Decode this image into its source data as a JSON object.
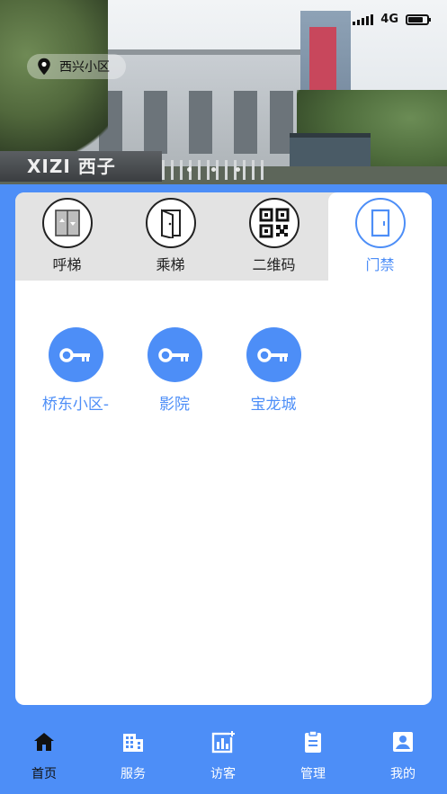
{
  "status_bar": {
    "network": "4G"
  },
  "header": {
    "location": "西兴小区",
    "banner_sign": "XIZI 西子",
    "banner_dots": 3
  },
  "tabs": [
    {
      "label": "呼梯",
      "icon": "call-elevator-icon",
      "active": false
    },
    {
      "label": "乘梯",
      "icon": "door-open-icon",
      "active": false
    },
    {
      "label": "二维码",
      "icon": "qr-code-icon",
      "active": false
    },
    {
      "label": "门禁",
      "icon": "door-icon",
      "active": true
    }
  ],
  "doors": [
    {
      "label": "桥东小区-",
      "icon": "key-icon"
    },
    {
      "label": "影院",
      "icon": "key-icon"
    },
    {
      "label": "宝龙城",
      "icon": "key-icon"
    }
  ],
  "bottom_nav": [
    {
      "label": "首页",
      "icon": "home-icon",
      "active": true
    },
    {
      "label": "服务",
      "icon": "building-icon",
      "active": false
    },
    {
      "label": "访客",
      "icon": "visitor-chart-icon",
      "active": false
    },
    {
      "label": "管理",
      "icon": "clipboard-icon",
      "active": false
    },
    {
      "label": "我的",
      "icon": "profile-icon",
      "active": false
    }
  ],
  "colors": {
    "accent": "#4d8ef7",
    "tab_bar_bg": "#e3e3e3",
    "card_bg": "#ffffff",
    "active_nav_label": "#111111"
  }
}
